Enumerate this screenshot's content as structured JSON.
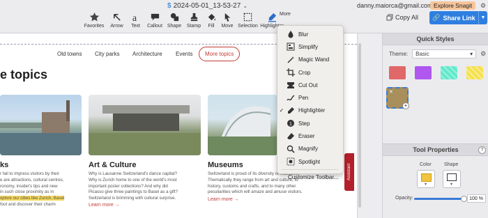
{
  "window": {
    "title": "2024-05-01_13-53-27"
  },
  "toolbar": {
    "tools": [
      {
        "label": "Favorites",
        "icon": "star-icon"
      },
      {
        "label": "Arrow",
        "icon": "arrow-icon"
      },
      {
        "label": "Text",
        "icon": "text-icon"
      },
      {
        "label": "Callout",
        "icon": "callout-icon"
      },
      {
        "label": "Shape",
        "icon": "shape-icon"
      },
      {
        "label": "Stamp",
        "icon": "stamp-icon"
      },
      {
        "label": "Fill",
        "icon": "fill-icon"
      },
      {
        "label": "Move",
        "icon": "move-icon"
      },
      {
        "label": "Selection",
        "icon": "selection-icon"
      },
      {
        "label": "Highlighter",
        "icon": "highlighter-icon"
      }
    ],
    "more_label": "More",
    "account": "danny.maiorca@gmail.com",
    "explore_label": "Explore Snagit",
    "copy_all_label": "Copy All",
    "share_label": "Share Link"
  },
  "more_menu": {
    "items": [
      {
        "label": "Blur",
        "icon": "blur-icon",
        "checked": false
      },
      {
        "label": "Simplify",
        "icon": "simplify-icon",
        "checked": false
      },
      {
        "label": "Magic Wand",
        "icon": "magic-wand-icon",
        "checked": false
      },
      {
        "label": "Crop",
        "icon": "crop-icon",
        "checked": false
      },
      {
        "label": "Cut Out",
        "icon": "cut-out-icon",
        "checked": false
      },
      {
        "label": "Pen",
        "icon": "pen-icon",
        "checked": false
      },
      {
        "label": "Highlighter",
        "icon": "highlighter-icon",
        "checked": true
      },
      {
        "label": "Step",
        "icon": "step-icon",
        "checked": false
      },
      {
        "label": "Eraser",
        "icon": "eraser-icon",
        "checked": false
      },
      {
        "label": "Magnify",
        "icon": "magnify-icon",
        "checked": false
      },
      {
        "label": "Spotlight",
        "icon": "spotlight-icon",
        "checked": false
      }
    ],
    "customize_label": "Customize Toolbar..."
  },
  "webpage": {
    "nav": [
      "Old towns",
      "City parks",
      "Architecture",
      "Events",
      "More topics"
    ],
    "heading": "e topics",
    "cards": [
      {
        "title": "ks",
        "text": [
          "r fail to impress visitors by their",
          "e are attractions, cultural centres,",
          "ronomy, insider's tips and new",
          "in such close proximity as in",
          "xplore our cities like Zurich, Basel",
          "foot and discover their charm"
        ]
      },
      {
        "title": "Art & Culture",
        "text": [
          "Why is Lausanne Switzerland's dance capital?",
          "Why is Zurich home to one of the world's most",
          "important poster collections? And why did",
          "Picasso give three paintings to Basel as a gift?",
          "Switzerland is brimming with cultural surprise."
        ],
        "link": "Learn more"
      },
      {
        "title": "Museums",
        "text": [
          "Switzerland is proud of its diversity of museums.",
          "Thematically they range from art and culture, to",
          "history, customs and crafts, and to many other",
          "peculiarities which will amaze and amuse visitors."
        ],
        "link": "Learn more"
      }
    ],
    "assistant_label": "Assistant"
  },
  "quick_styles": {
    "title": "Quick Styles",
    "theme_label": "Theme:",
    "theme_value": "Basic",
    "swatches": [
      "#e06868",
      "#b057ef",
      "#5ee8c9",
      "#f4e048"
    ]
  },
  "tool_properties": {
    "title": "Tool Properties",
    "color_label": "Color",
    "shape_label": "Shape",
    "color_value": "#f2c33c",
    "opacity_label": "Opacity:",
    "opacity_value": "100 %"
  }
}
